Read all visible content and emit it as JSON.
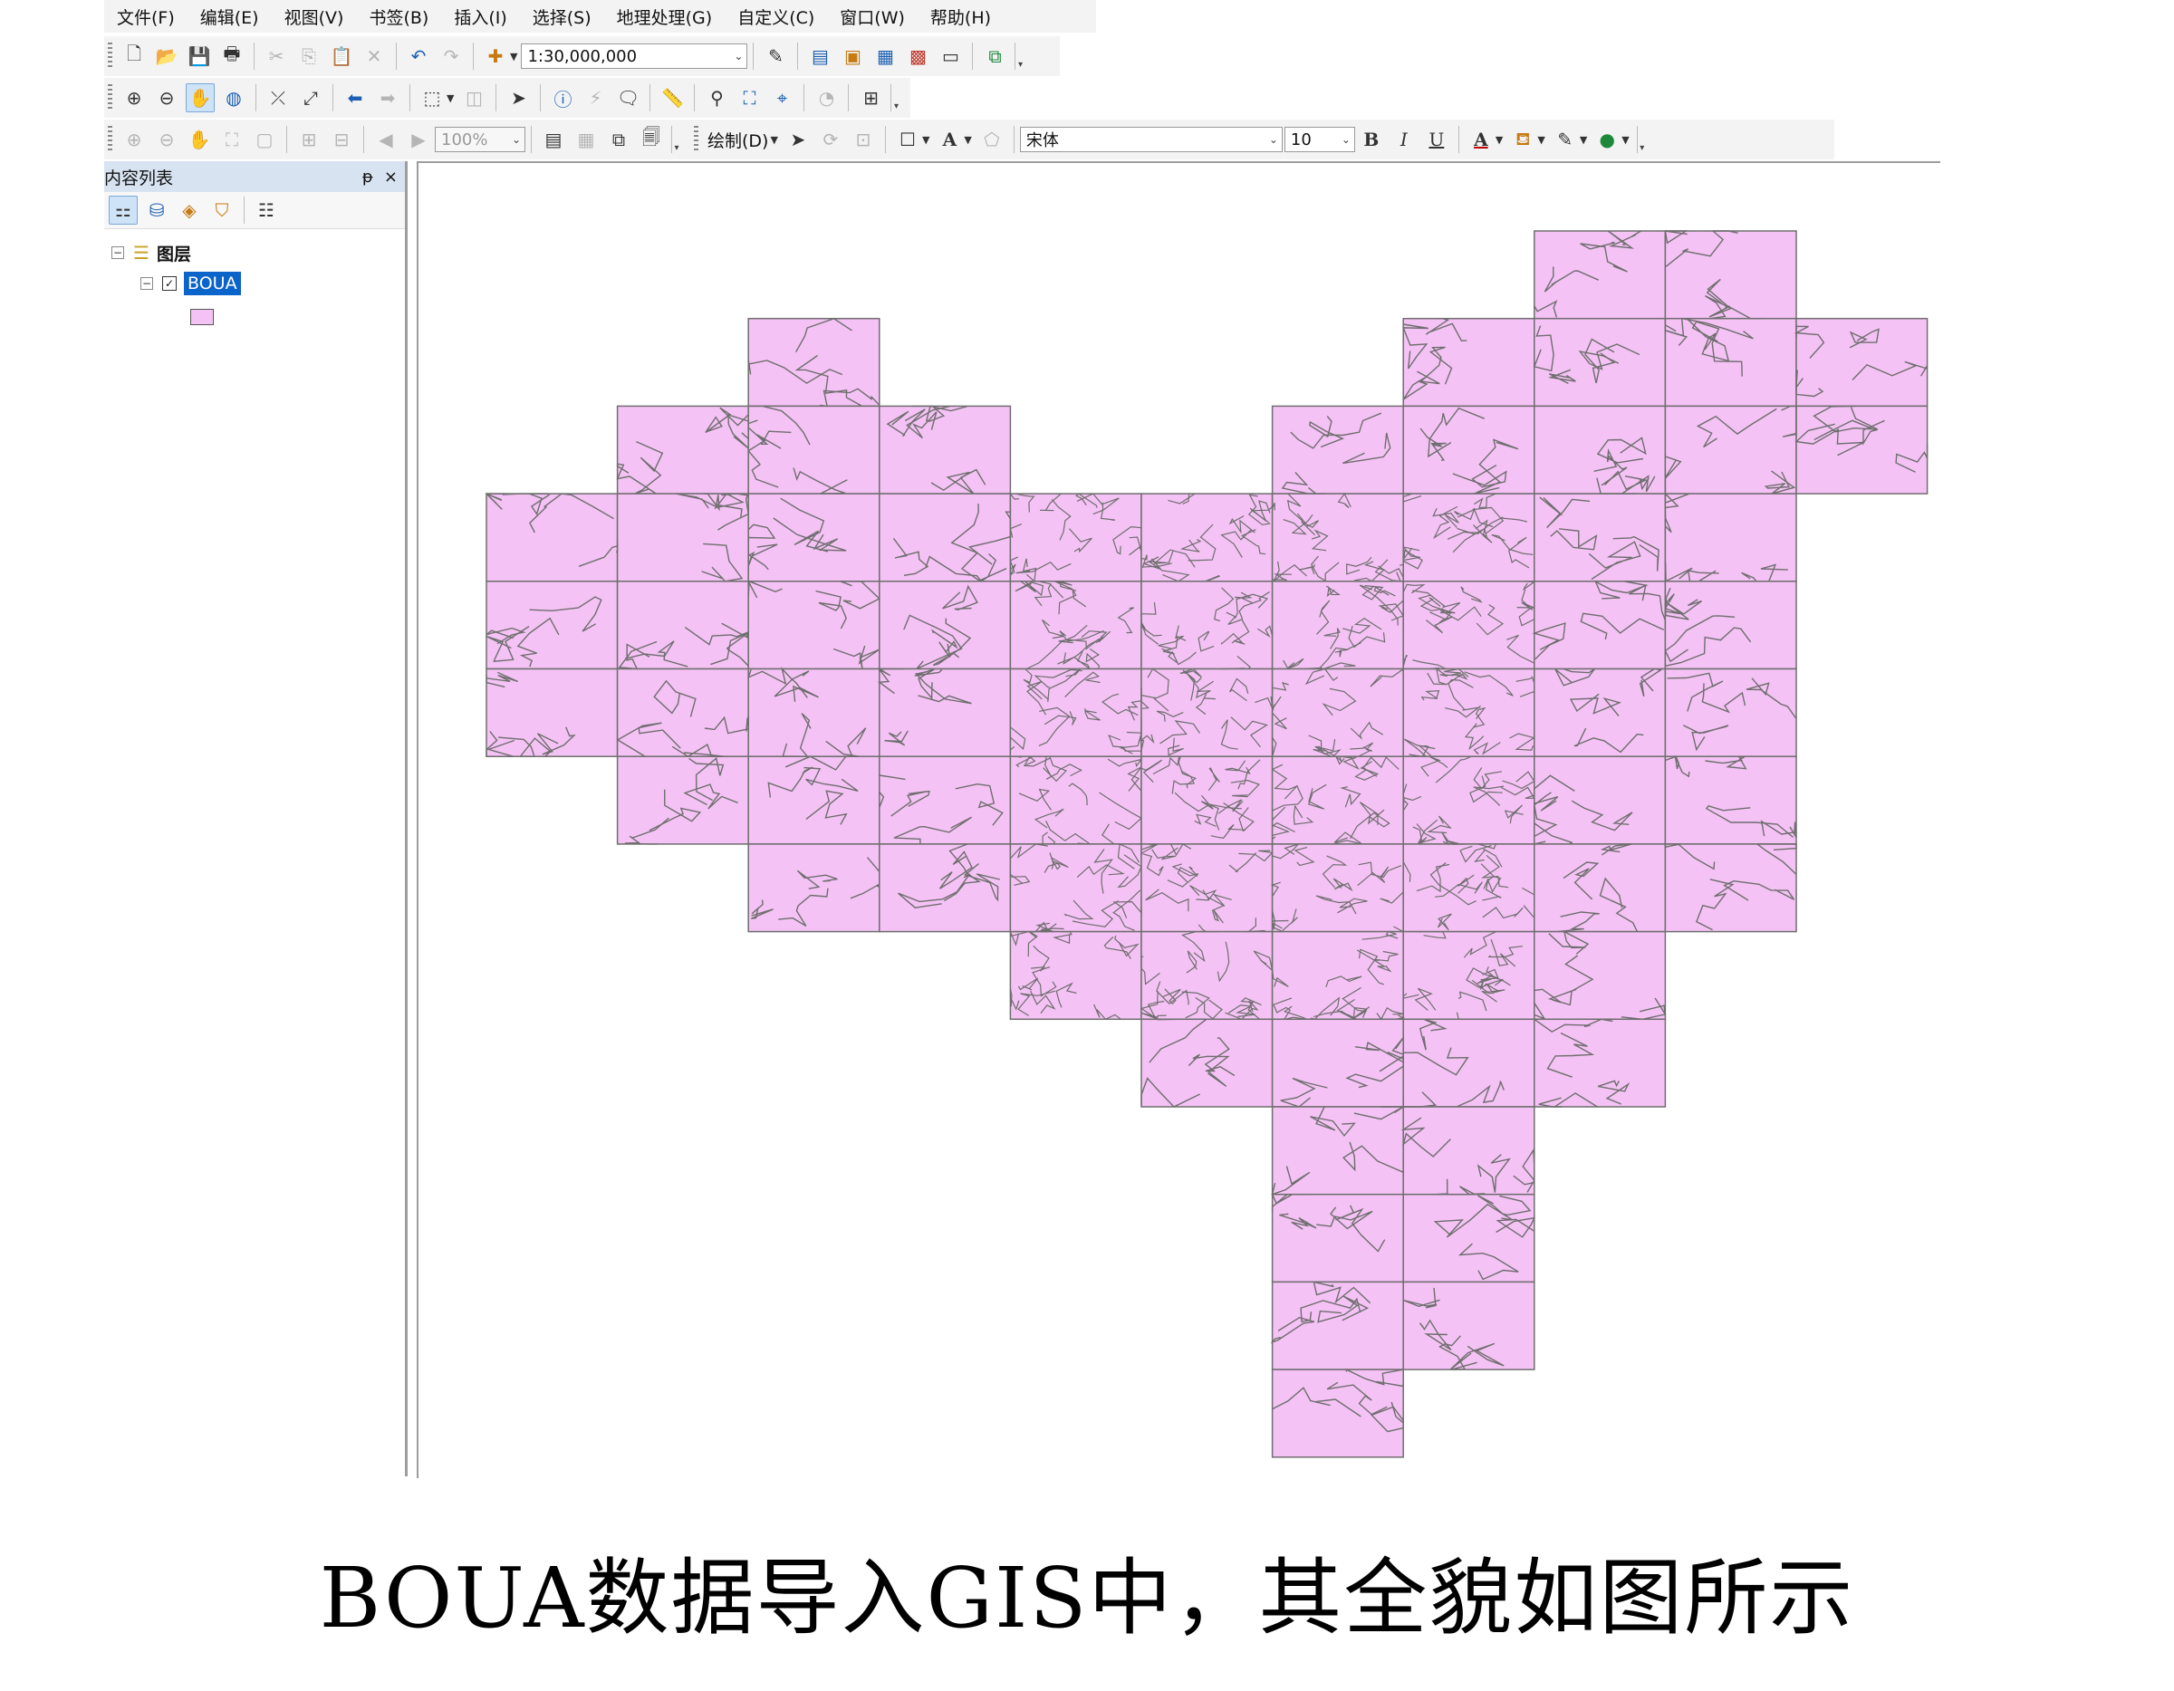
{
  "menu": [
    "文件(F)",
    "编辑(E)",
    "视图(V)",
    "书签(B)",
    "插入(I)",
    "选择(S)",
    "地理处理(G)",
    "自定义(C)",
    "窗口(W)",
    "帮助(H)"
  ],
  "toolbar1": {
    "scale": "1:30,000,000"
  },
  "toolbar3": {
    "zoom": "100%",
    "draw_label": "绘制(D)",
    "font": "宋体",
    "font_size": "10",
    "bold": "B",
    "italic": "I",
    "underline": "U"
  },
  "toc": {
    "title": "内容列表",
    "pin": "ᵽ",
    "close": "×",
    "group": "图层",
    "layer": "BOUA",
    "layer_checked": true
  },
  "colors": {
    "tile_fill": "#f5c2f5",
    "tile_stroke": "#6e6e6e",
    "selection": "#0a64c9"
  },
  "map": {
    "tile_rows": [
      {
        "row": 0,
        "cols": [
          8,
          9
        ]
      },
      {
        "row": 1,
        "cols": [
          2,
          7,
          8,
          9,
          10
        ]
      },
      {
        "row": 2,
        "cols": [
          1,
          2,
          3,
          6,
          7,
          8,
          9,
          10
        ]
      },
      {
        "row": 3,
        "cols": [
          0,
          1,
          2,
          3,
          4,
          5,
          6,
          7,
          8,
          9
        ]
      },
      {
        "row": 4,
        "cols": [
          0,
          1,
          2,
          3,
          4,
          5,
          6,
          7,
          8,
          9
        ]
      },
      {
        "row": 5,
        "cols": [
          0,
          1,
          2,
          3,
          4,
          5,
          6,
          7,
          8,
          9
        ]
      },
      {
        "row": 6,
        "cols": [
          1,
          2,
          3,
          4,
          5,
          6,
          7,
          8,
          9
        ]
      },
      {
        "row": 7,
        "cols": [
          2,
          3,
          4,
          5,
          6,
          7,
          8,
          9
        ]
      },
      {
        "row": 8,
        "cols": [
          4,
          5,
          6,
          7,
          8
        ]
      },
      {
        "row": 9,
        "cols": [
          5,
          6,
          7,
          8
        ]
      },
      {
        "row": 10,
        "cols": [
          6,
          7
        ]
      },
      {
        "row": 11,
        "cols": [
          6,
          7
        ]
      },
      {
        "row": 12,
        "cols": [
          6,
          7
        ]
      },
      {
        "row": 13,
        "cols": [
          6
        ]
      }
    ]
  },
  "caption": "BOUA数据导入GIS中，其全貌如图所示"
}
